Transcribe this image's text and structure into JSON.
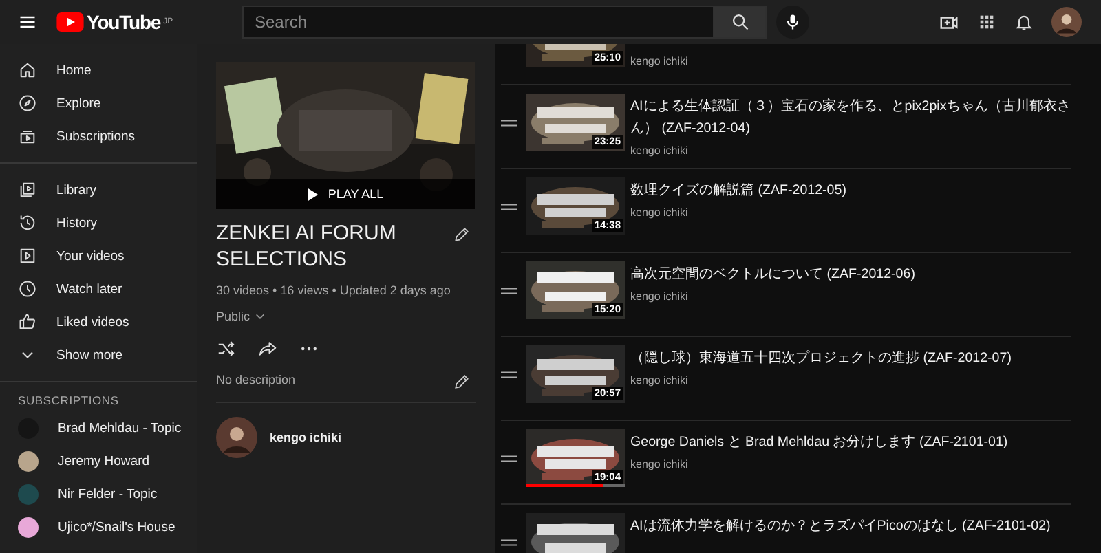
{
  "header": {
    "logo": "YouTube",
    "region": "JP",
    "search": {
      "placeholder": "Search"
    }
  },
  "sidebar": {
    "items": [
      {
        "label": "Home"
      },
      {
        "label": "Explore"
      },
      {
        "label": "Subscriptions"
      },
      {
        "label": "Library"
      },
      {
        "label": "History"
      },
      {
        "label": "Your videos"
      },
      {
        "label": "Watch later"
      },
      {
        "label": "Liked videos"
      },
      {
        "label": "Show more"
      }
    ],
    "subscriptions_heading": "SUBSCRIPTIONS",
    "subscriptions": [
      {
        "name": "Brad Mehldau - Topic"
      },
      {
        "name": "Jeremy Howard"
      },
      {
        "name": "Nir Felder - Topic"
      },
      {
        "name": "Ujico*/Snail's House"
      }
    ]
  },
  "playlist": {
    "play_all": "PLAY ALL",
    "title": "ZENKEI AI FORUM SELECTIONS",
    "stats": "30 videos • 16 views • Updated 2 days ago",
    "visibility": "Public",
    "description": "No description",
    "owner": "kengo ichiki"
  },
  "videos": [
    {
      "duration": "25:10",
      "channel": "kengo ichiki"
    },
    {
      "title": "AIによる生体認証（３）宝石の家を作る、とpix2pixちゃん（古川郁衣さん） (ZAF-2012-04)",
      "duration": "23:25",
      "channel": "kengo ichiki"
    },
    {
      "title": "数理クイズの解説篇 (ZAF-2012-05)",
      "duration": "14:38",
      "channel": "kengo ichiki"
    },
    {
      "title": "高次元空間のベクトルについて (ZAF-2012-06)",
      "duration": "15:20",
      "channel": "kengo ichiki"
    },
    {
      "title": "（隠し球）東海道五十四次プロジェクトの進捗 (ZAF-2012-07)",
      "duration": "20:57",
      "channel": "kengo ichiki"
    },
    {
      "title": "George Daniels と Brad Mehldau お分けします (ZAF-2101-01)",
      "duration": "19:04",
      "channel": "kengo ichiki",
      "level": 0.78
    },
    {
      "title": "AIは流体力学を解けるのか？とラズパイPicoのはなし (ZAF-2101-02)"
    }
  ]
}
